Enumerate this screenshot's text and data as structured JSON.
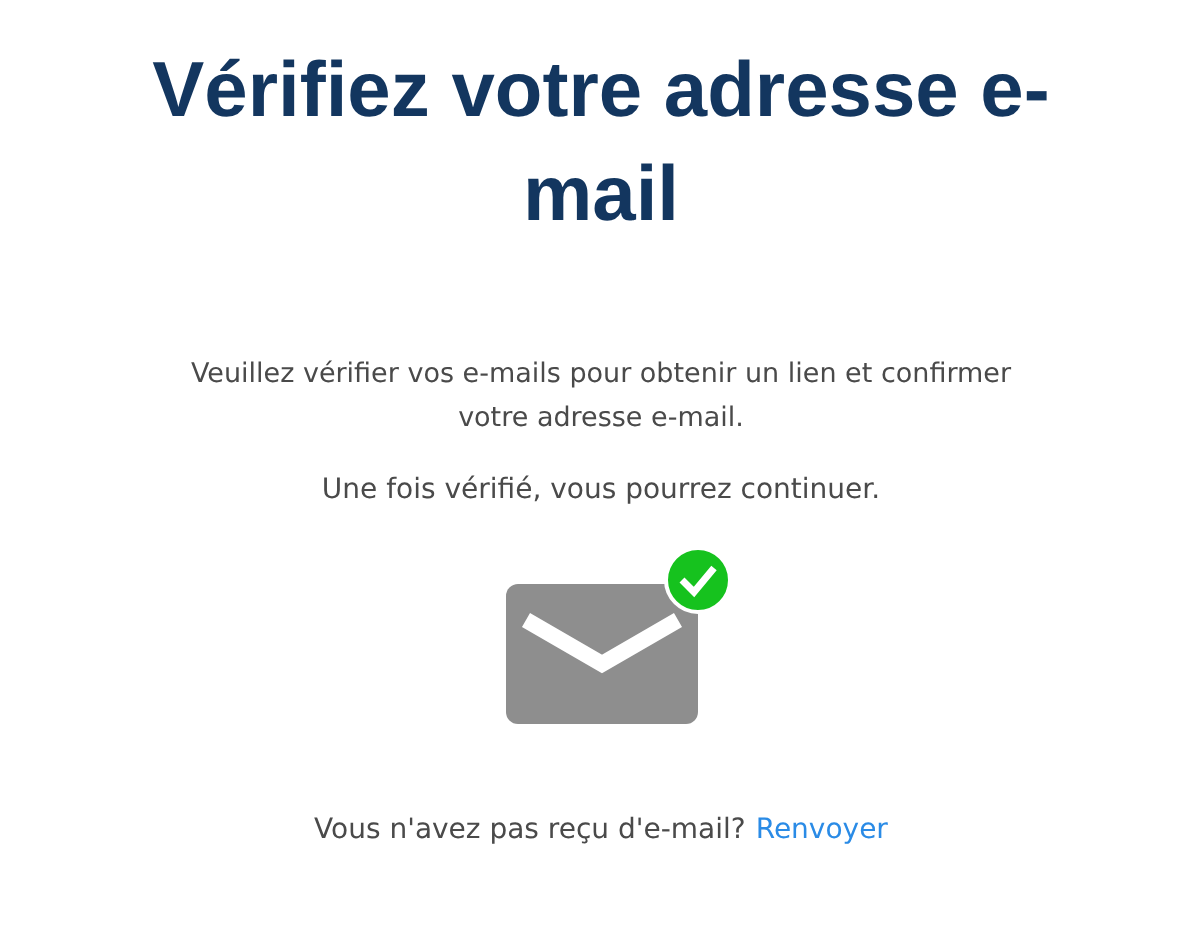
{
  "title": "Vérifiez votre adresse e-mail",
  "paragraphs": [
    "Veuillez vérifier vos e-mails pour obtenir un lien et confirmer votre adresse e-mail.",
    "Une fois vérifié, vous pourrez continuer."
  ],
  "envelope": {
    "verified": true
  },
  "footer": {
    "text": "Vous n'avez pas reçu d'e-mail?",
    "link": "Renvoyer"
  }
}
